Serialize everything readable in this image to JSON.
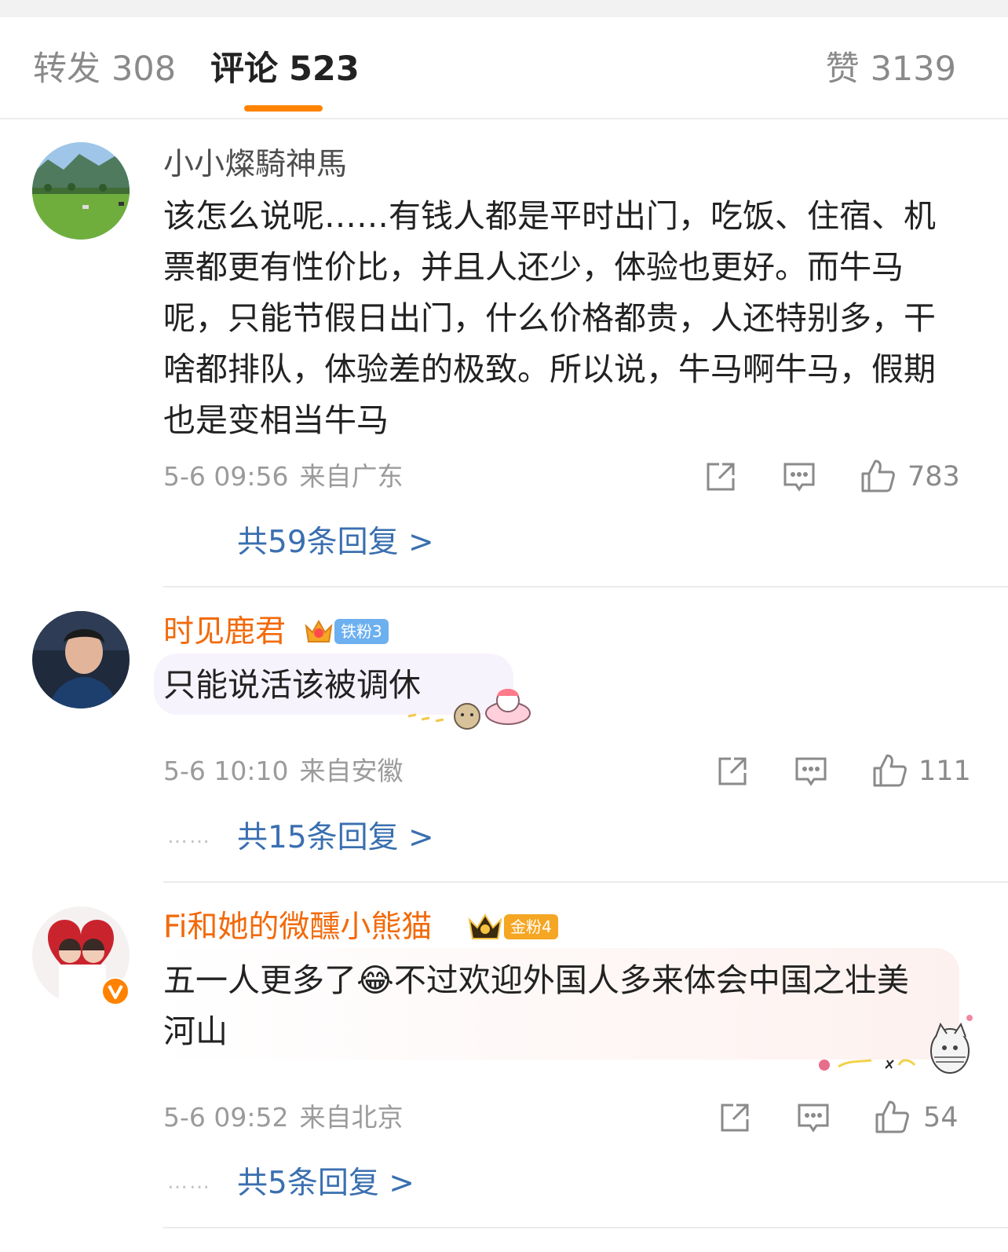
{
  "tabs": {
    "repost": {
      "label": "转发",
      "count": "308"
    },
    "comment": {
      "label": "评论",
      "count": "523"
    },
    "like": {
      "label": "赞",
      "count": "3139"
    }
  },
  "comments": [
    {
      "user": "小小燦騎神馬",
      "text": "该怎么说呢……有钱人都是平时出门，吃饭、住宿、机票都更有性价比，并且人还少，体验也更好。而牛马呢，只能节假日出门，什么价格都贵，人还特别多，干啥都排队，体验差的极致。所以说，牛马啊牛马，假期也是变相当牛马",
      "time": "5-6 09:56",
      "location": "来自广东",
      "likes": "783",
      "replies": "共59条回复 >",
      "dots": ""
    },
    {
      "user": "时见鹿君",
      "badge": "铁粉3",
      "text": "只能说活该被调休",
      "time": "5-6 10:10",
      "location": "来自安徽",
      "likes": "111",
      "replies": "共15条回复 >",
      "dots": "……"
    },
    {
      "user": "Fi和她的微醺小熊猫",
      "badge": "金粉4",
      "text_before": "五一人更多了",
      "emoji": "😂",
      "text_after": "不过欢迎外国人多来体会中国之壮美河山",
      "time": "5-6 09:52",
      "location": "来自北京",
      "likes": "54",
      "replies": "共5条回复 >",
      "dots": "……"
    }
  ],
  "icons": {
    "repost": "share-icon",
    "comment": "comment-icon",
    "like": "thumbs-up-icon",
    "verified": "verified-v-icon"
  },
  "colors": {
    "accent": "#ff8200",
    "vip_name": "#f26a0b",
    "link": "#3a6fb0",
    "iron_badge": "#6db0f0",
    "gold_badge": "#f5a623"
  }
}
